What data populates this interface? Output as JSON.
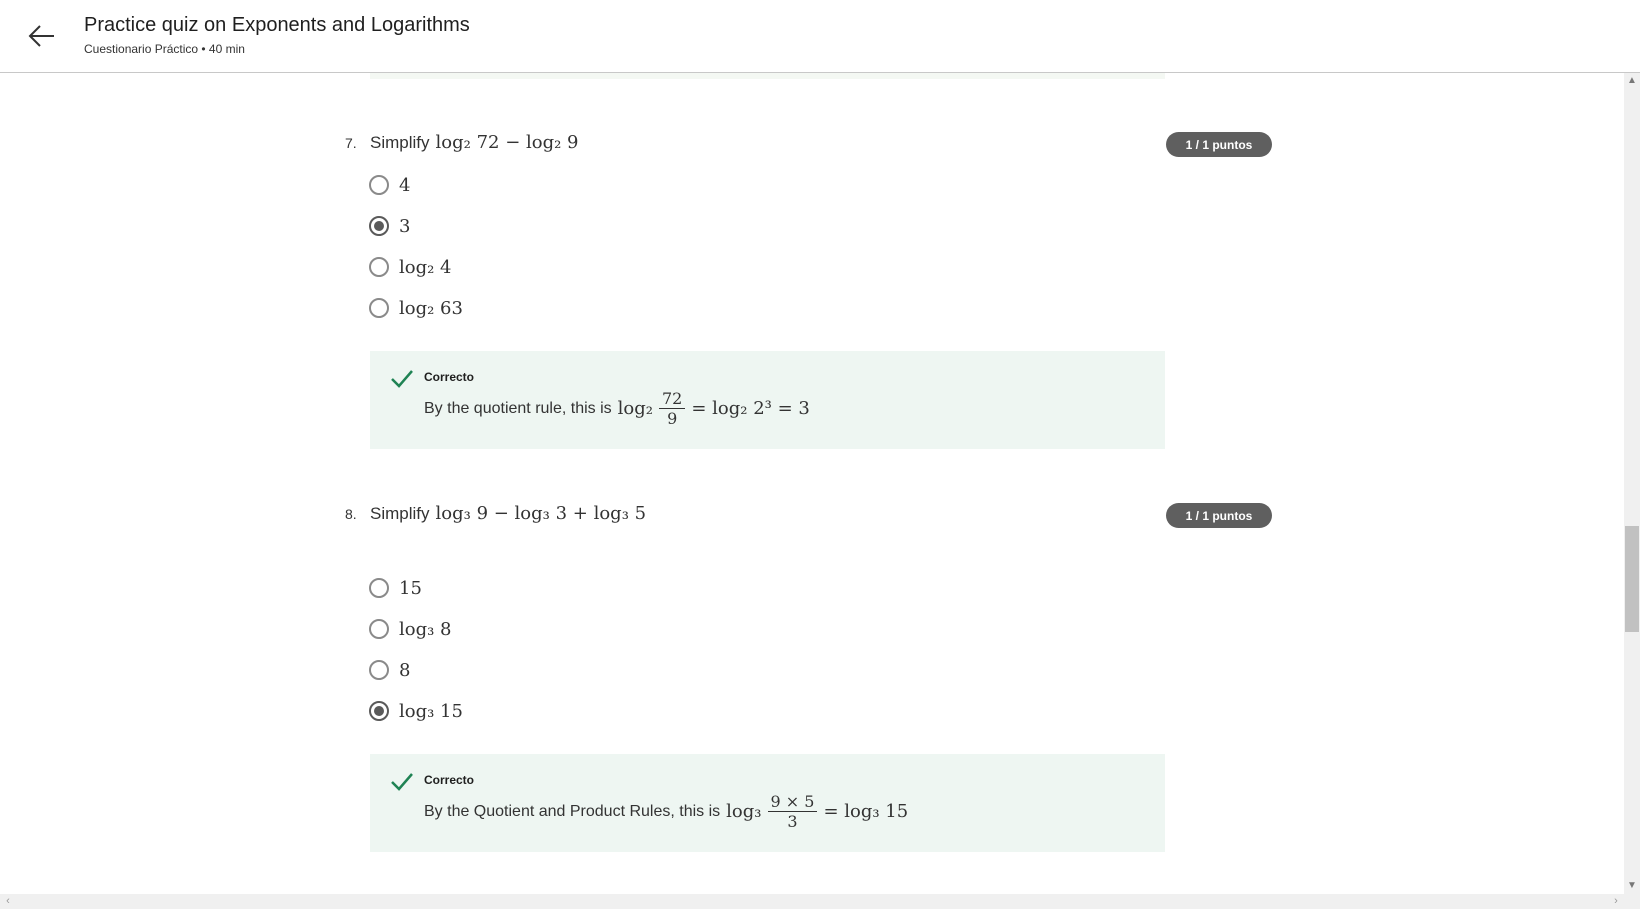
{
  "header": {
    "title": "Practice quiz on Exponents and Logarithms",
    "subtitle": "Cuestionario Práctico • 40 min"
  },
  "questions": [
    {
      "number": "7.",
      "prompt_prefix": "Simplify",
      "prompt_math": "log₂ 72 − log₂ 9",
      "points": "1 / 1 puntos",
      "options": [
        {
          "label": "4",
          "selected": false
        },
        {
          "label": "3",
          "selected": true
        },
        {
          "label": "log₂ 4",
          "selected": false
        },
        {
          "label": "log₂ 63",
          "selected": false
        }
      ],
      "feedback": {
        "status": "Correcto",
        "text": "By the quotient rule, this is",
        "math_pre": "log₂",
        "frac_num": "72",
        "frac_den": "9",
        "math_post": "= log₂ 2³ = 3"
      }
    },
    {
      "number": "8.",
      "prompt_prefix": "Simplify",
      "prompt_math": "log₃ 9 − log₃ 3 + log₃ 5",
      "points": "1 / 1 puntos",
      "options": [
        {
          "label": "15",
          "selected": false
        },
        {
          "label": "log₃ 8",
          "selected": false
        },
        {
          "label": "8",
          "selected": false
        },
        {
          "label": "log₃ 15",
          "selected": true
        }
      ],
      "feedback": {
        "status": "Correcto",
        "text": "By the Quotient and Product Rules, this is",
        "math_pre": "log₃",
        "frac_num": "9 × 5",
        "frac_den": "3",
        "math_post": "= log₃ 15"
      }
    }
  ],
  "colors": {
    "accent_green": "#1f8354",
    "feedback_bg": "#eef6f2",
    "points_badge": "#5f5f5f"
  }
}
